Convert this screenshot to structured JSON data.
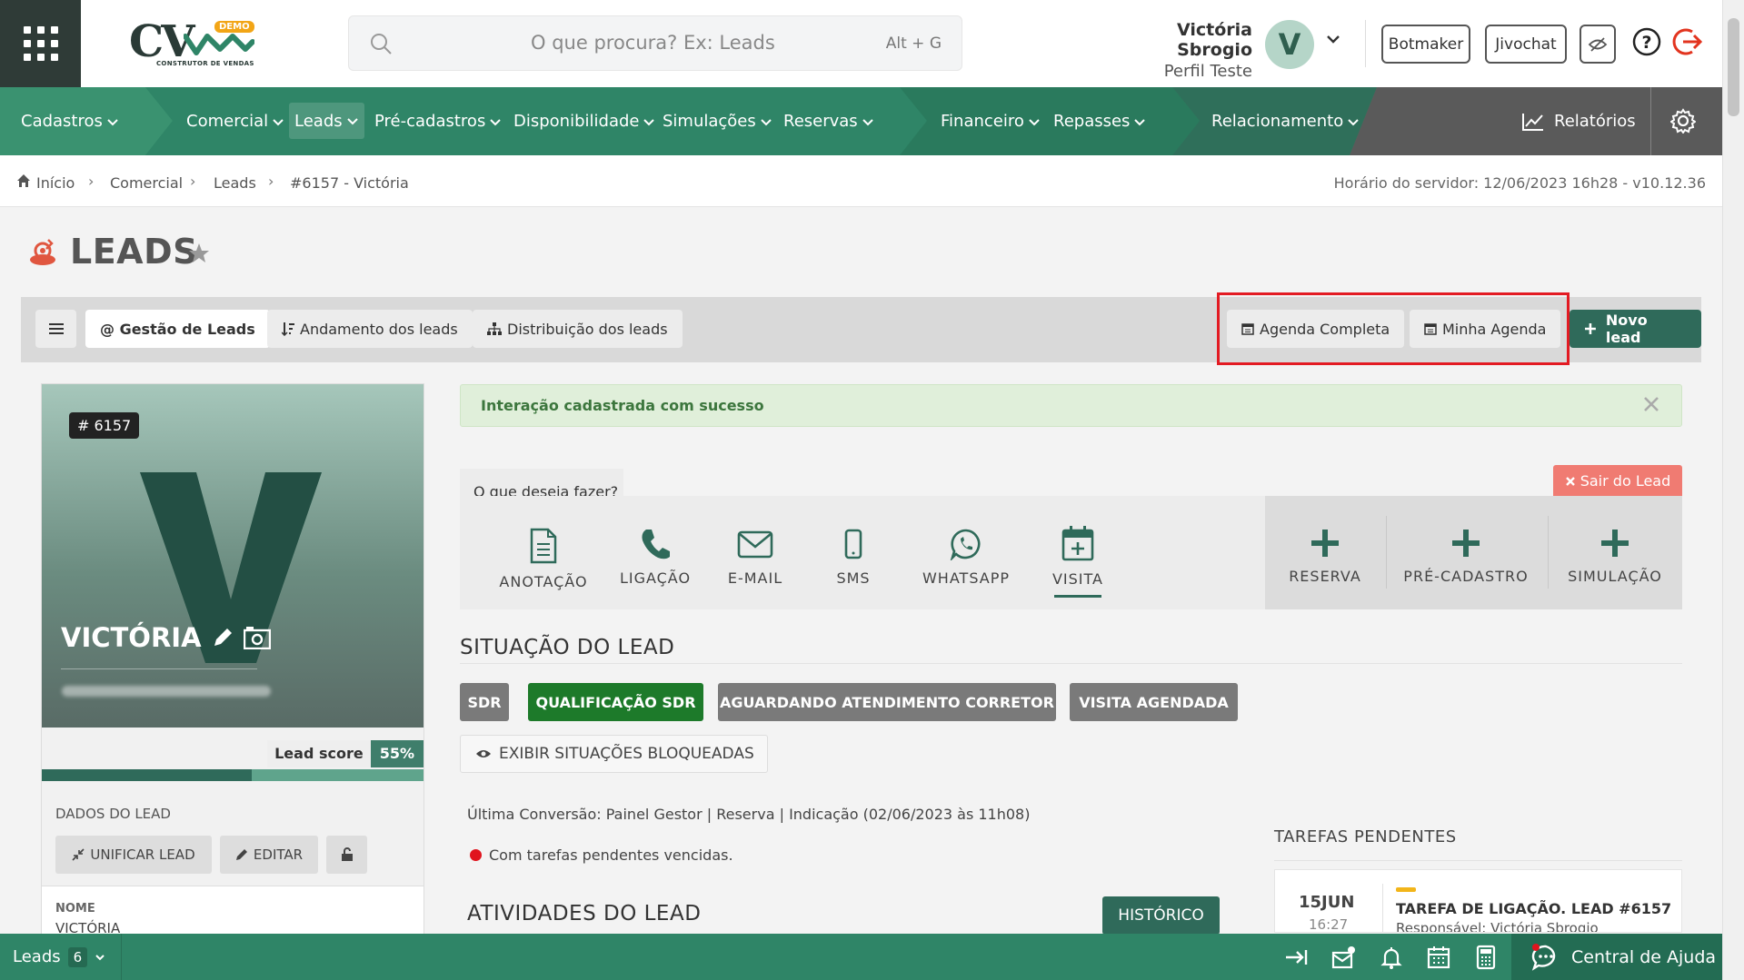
{
  "header": {
    "logo_text": "CV",
    "logo_badge": "DEMO",
    "logo_tagline": "CONSTRUTOR DE VENDAS",
    "search_placeholder": "O que procura? Ex: Leads",
    "search_shortcut": "Alt + G",
    "user_name": "Victória Sbrogio",
    "user_role": "Perfil Teste",
    "avatar_letter": "V",
    "buttons": {
      "botmaker": "Botmaker",
      "jivochat": "Jivochat"
    }
  },
  "nav": {
    "items": [
      "Cadastros",
      "Comercial",
      "Leads",
      "Pré-cadastros",
      "Disponibilidade",
      "Simulações",
      "Reservas",
      "Financeiro",
      "Repasses",
      "Relacionamento"
    ],
    "reports": "Relatórios"
  },
  "breadcrumb": {
    "items": [
      "Início",
      "Comercial",
      "Leads",
      "#6157 - Victória"
    ],
    "server_time": "Horário do servidor: 12/06/2023 16h28 - v10.12.36"
  },
  "page": {
    "title": "LEADS"
  },
  "toolbar": {
    "gestao": "@ Gestão de Leads",
    "andamento": "Andamento dos leads",
    "distribuicao": "Distribuição dos leads",
    "agenda_completa": "Agenda Completa",
    "minha_agenda": "Minha Agenda",
    "novo_lead": "Novo lead"
  },
  "lead": {
    "id": "# 6157",
    "avatar_letter": "V",
    "name": "VICTÓRIA",
    "score_label": "Lead score",
    "score_value": "55%",
    "score_fraction": 0.55,
    "section_label": "DADOS DO LEAD",
    "btn_unificar": "UNIFICAR LEAD",
    "btn_editar": "EDITAR",
    "field_nome_label": "NOME",
    "field_nome_value": "VICTÓRIA"
  },
  "alert": {
    "text": "Interação cadastrada com sucesso"
  },
  "actions": {
    "prompt": "O que deseja fazer?",
    "exit": "Sair do Lead",
    "items": [
      "ANOTAÇÃO",
      "LIGAÇÃO",
      "E-MAIL",
      "SMS",
      "WHATSAPP",
      "VISITA"
    ],
    "create": [
      "RESERVA",
      "PRÉ-CADASTRO",
      "SIMULAÇÃO"
    ]
  },
  "situacao": {
    "title": "SITUAÇÃO DO LEAD",
    "statuses": [
      "SDR",
      "QUALIFICAÇÃO SDR",
      "AGUARDANDO ATENDIMENTO CORRETOR",
      "VISITA AGENDADA"
    ],
    "show_blocked": "EXIBIR SITUAÇÕES BLOQUEADAS",
    "last_conversion": "Última Conversão: Painel Gestor | Reserva | Indicação (02/06/2023 às 11h08)",
    "pending_note": "Com tarefas pendentes vencidas."
  },
  "atividades": {
    "title": "ATIVIDADES DO LEAD",
    "history_btn": "HISTÓRICO"
  },
  "tasks": {
    "title": "TAREFAS PENDENTES",
    "items": [
      {
        "day": "15JUN",
        "time": "16:27",
        "title": "TAREFA DE LIGAÇÃO. LEAD #6157",
        "responsible": "Responsável: Victória Sbrogio"
      }
    ]
  },
  "bottombar": {
    "leads_label": "Leads",
    "leads_count": "6",
    "help": "Central de Ajuda"
  },
  "colors": {
    "brand_green": "#2f8567",
    "dark_green": "#2f6a5a",
    "alert_red": "#e31b23"
  }
}
